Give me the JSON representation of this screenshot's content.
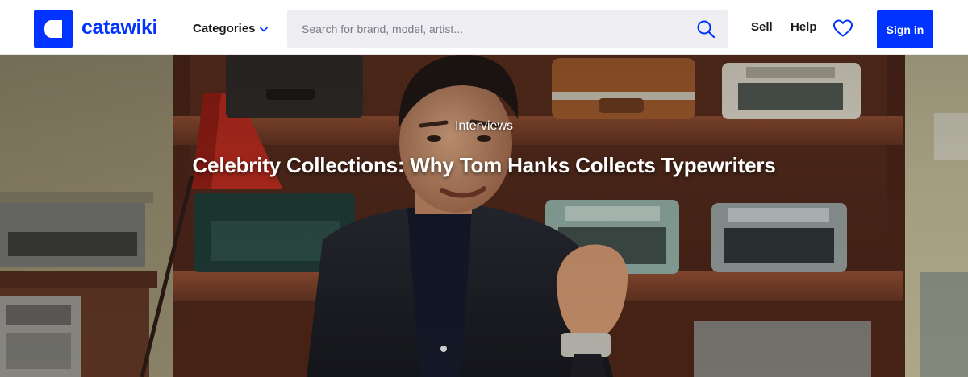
{
  "brand": {
    "name": "catawiki",
    "color": "#0033ff"
  },
  "header": {
    "categories_label": "Categories",
    "search": {
      "placeholder": "Search for brand, model, artist...",
      "value": ""
    },
    "sell_label": "Sell",
    "help_label": "Help",
    "signin_label": "Sign in",
    "icons": {
      "logo": "catawiki-logo-icon",
      "categories": "chevron-down-icon",
      "search": "search-icon",
      "favorites": "heart-icon"
    }
  },
  "hero": {
    "kicker": "Interviews",
    "title": "Celebrity Collections: Why Tom Hanks Collects Typewriters",
    "background": "photo-of-man-in-front-of-typewriter-shelves"
  },
  "colors": {
    "accent": "#0033ff",
    "text": "#1a1a1a",
    "search_bg": "#eeeef2"
  }
}
